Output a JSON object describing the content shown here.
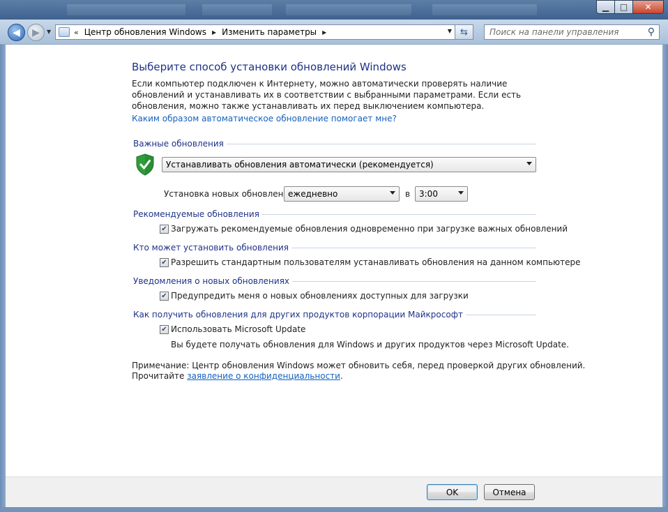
{
  "window": {
    "controls": {
      "minimize": "▁",
      "maximize": "□",
      "close": "✕"
    }
  },
  "nav": {
    "back_glyph": "◀",
    "forward_glyph": "▶",
    "address_prefix": "«",
    "breadcrumbs": [
      "Центр обновления Windows",
      "Изменить параметры"
    ],
    "search_placeholder": "Поиск на панели управления"
  },
  "page": {
    "title": "Выберите способ установки обновлений Windows",
    "intro": "Если компьютер подключен к Интернету, можно автоматически проверять наличие обновлений и устанавливать их в соответствии с выбранными параметрами. Если есть обновления, можно также устанавливать их перед выключением компьютера.",
    "help_link": "Каким образом автоматическое обновление помогает мне?"
  },
  "important": {
    "heading": "Важные обновления",
    "mode_value": "Устанавливать обновления автоматически (рекомендуется)",
    "schedule_label": "Установка новых обновлений:",
    "frequency_value": "ежедневно",
    "at_label": "в",
    "time_value": "3:00"
  },
  "recommended": {
    "heading": "Рекомендуемые обновления",
    "checkbox_label": "Загружать рекомендуемые обновления одновременно при загрузке важных обновлений",
    "checked": true
  },
  "who": {
    "heading": "Кто может установить обновления",
    "checkbox_label": "Разрешить стандартным пользователям устанавливать обновления на данном компьютере",
    "checked": true
  },
  "notify": {
    "heading": "Уведомления о новых обновлениях",
    "checkbox_label": "Предупредить меня о новых обновлениях доступных для загрузки",
    "checked": true
  },
  "microsoft": {
    "heading": "Как получить обновления для других продуктов корпорации Майкрософт",
    "checkbox_label": "Использовать Microsoft Update",
    "checked": true,
    "description": "Вы будете получать обновления для Windows и других продуктов через Microsoft Update."
  },
  "note": {
    "line1": "Примечание: Центр обновления Windows может обновить себя, перед проверкой других обновлений.",
    "line2_prefix": "Прочитайте",
    "privacy_link": "заявление о конфиденциальности",
    "line2_suffix": "."
  },
  "buttons": {
    "ok": "OK",
    "cancel": "Отмена"
  },
  "colors": {
    "heading": "#1e3287",
    "link": "#1560bd",
    "window_frame": "#3e628f"
  }
}
